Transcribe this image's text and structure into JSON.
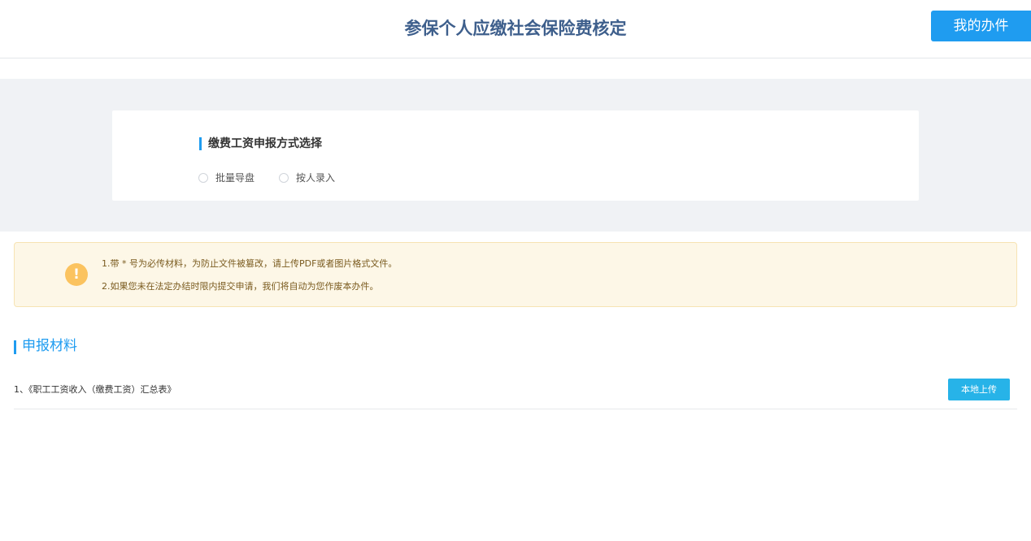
{
  "header": {
    "title": "参保个人应缴社会保险费核定",
    "my_affairs_label": "我的办件"
  },
  "declaration_method": {
    "title": "缴费工资申报方式选择",
    "options": [
      {
        "label": "批量导盘",
        "selected": false
      },
      {
        "label": "按人录入",
        "selected": false
      }
    ]
  },
  "notice": {
    "icon": "exclamation-icon",
    "lines": [
      "1.带 * 号为必传材料，为防止文件被篡改，请上传PDF或者图片格式文件。",
      "2.如果您未在法定办结时限内提交申请，我们将自动为您作废本办件。"
    ]
  },
  "materials": {
    "section_title": "申报材料",
    "items": [
      {
        "name": "1、《职工工资收入（缴费工资）汇总表》",
        "upload_label": "本地上传"
      }
    ]
  },
  "colors": {
    "accent": "#1f9cf0",
    "title": "#3e5f8c",
    "warning": "#fbc35f"
  }
}
